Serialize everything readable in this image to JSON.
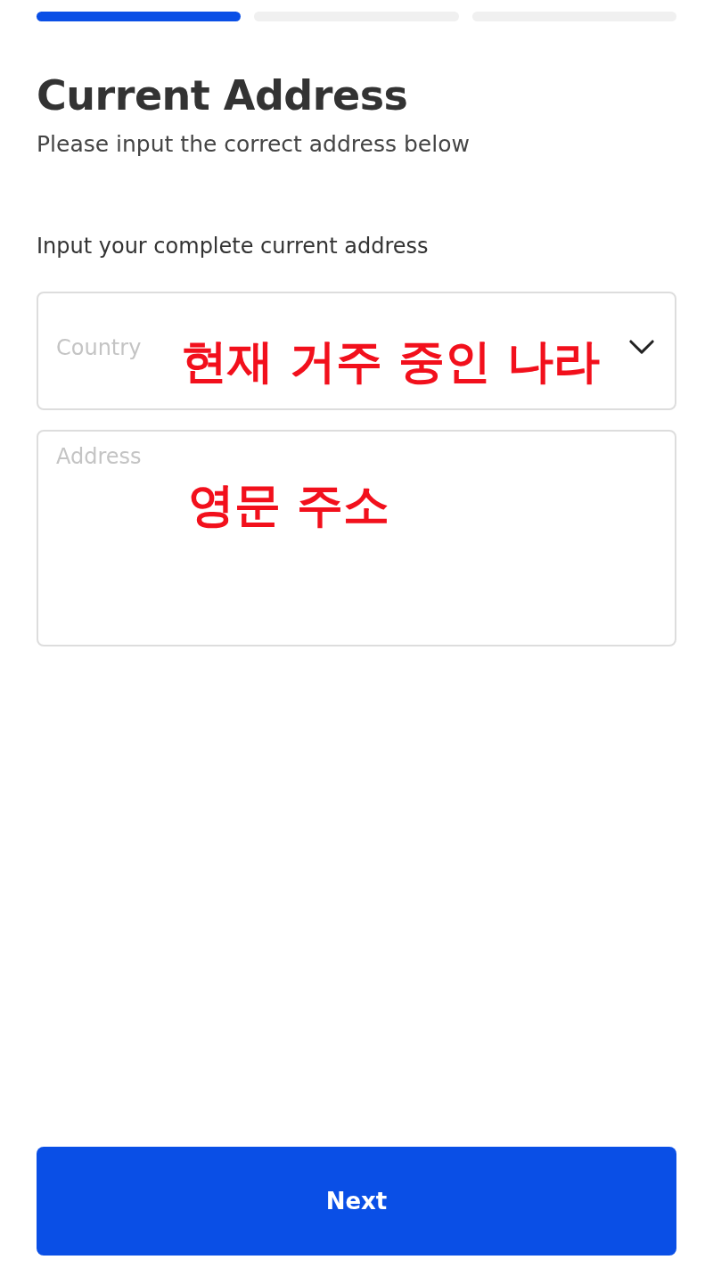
{
  "progress_steps": [
    {
      "active": true
    },
    {
      "active": false
    },
    {
      "active": false
    }
  ],
  "title": "Current Address",
  "subtitle": "Please input the correct address below",
  "form_label": "Input your complete current address",
  "country_field": {
    "placeholder": "Country",
    "annotation": "현재 거주 중인 나라"
  },
  "address_field": {
    "placeholder": "Address",
    "annotation": "영문 주소"
  },
  "next_button": {
    "label": "Next"
  }
}
